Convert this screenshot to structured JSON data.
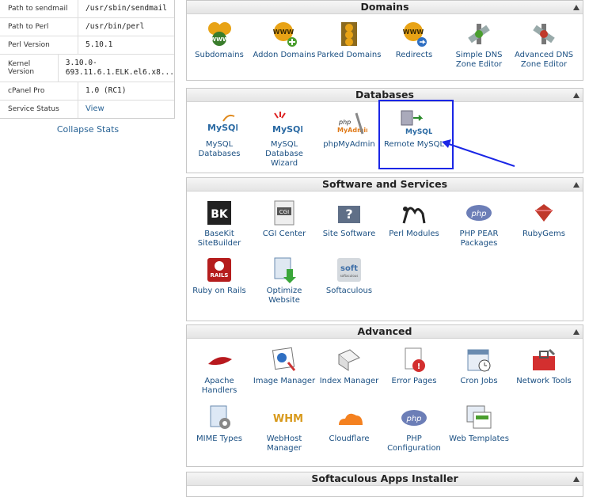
{
  "stats": {
    "rows": [
      {
        "label": "Path to sendmail",
        "value": "/usr/sbin/sendmail"
      },
      {
        "label": "Path to Perl",
        "value": "/usr/bin/perl"
      },
      {
        "label": "Perl Version",
        "value": "5.10.1"
      },
      {
        "label": "Kernel Version",
        "value": "3.10.0-\n693.11.6.1.ELK.el6.x8..."
      },
      {
        "label": "cPanel Pro",
        "value": "1.0 (RC1)"
      },
      {
        "label": "Service Status",
        "value": "View"
      }
    ],
    "collapse_label": "Collapse Stats"
  },
  "domains": {
    "title": "Domains",
    "items": [
      {
        "label": "Subdomains",
        "icon": "www-globes-icon"
      },
      {
        "label": "Addon Domains",
        "icon": "www-addon-icon"
      },
      {
        "label": "Parked Domains",
        "icon": "www-parked-icon"
      },
      {
        "label": "Redirects",
        "icon": "www-redirect-icon"
      },
      {
        "label": "Simple DNS Zone Editor",
        "icon": "dns-satellite-icon"
      },
      {
        "label": "Advanced DNS Zone Editor",
        "icon": "dns-advanced-icon"
      }
    ]
  },
  "databases": {
    "title": "Databases",
    "items": [
      {
        "label": "MySQL Databases",
        "icon": "mysql-dolphin-icon"
      },
      {
        "label": "MySQL Database Wizard",
        "icon": "mysql-wizard-icon"
      },
      {
        "label": "phpMyAdmin",
        "icon": "phpmyadmin-icon"
      },
      {
        "label": "Remote MySQL",
        "icon": "remote-mysql-icon"
      }
    ]
  },
  "software": {
    "title": "Software and Services",
    "items": [
      {
        "label": "BaseKit SiteBuilder",
        "icon": "basekit-icon"
      },
      {
        "label": "CGI Center",
        "icon": "cgi-icon"
      },
      {
        "label": "Site Software",
        "icon": "site-software-icon"
      },
      {
        "label": "Perl Modules",
        "icon": "perl-camel-icon"
      },
      {
        "label": "PHP PEAR Packages",
        "icon": "php-pear-icon"
      },
      {
        "label": "RubyGems",
        "icon": "rubygems-icon"
      },
      {
        "label": "Ruby on Rails",
        "icon": "rails-icon"
      },
      {
        "label": "Optimize Website",
        "icon": "optimize-icon"
      },
      {
        "label": "Softaculous",
        "icon": "softaculous-icon"
      }
    ]
  },
  "advanced": {
    "title": "Advanced",
    "items": [
      {
        "label": "Apache Handlers",
        "icon": "apache-feather-icon"
      },
      {
        "label": "Image Manager",
        "icon": "image-manager-icon"
      },
      {
        "label": "Index Manager",
        "icon": "index-manager-icon"
      },
      {
        "label": "Error Pages",
        "icon": "error-pages-icon"
      },
      {
        "label": "Cron Jobs",
        "icon": "cron-calendar-icon"
      },
      {
        "label": "Network Tools",
        "icon": "network-toolbox-icon"
      },
      {
        "label": "MIME Types",
        "icon": "mime-types-icon"
      },
      {
        "label": "WebHost Manager",
        "icon": "whm-icon"
      },
      {
        "label": "Cloudflare",
        "icon": "cloudflare-icon"
      },
      {
        "label": "PHP Configuration",
        "icon": "php-config-icon"
      },
      {
        "label": "Web Templates",
        "icon": "web-templates-icon"
      }
    ]
  },
  "softaculous_installer": {
    "title": "Softaculous Apps Installer"
  },
  "icon_texts": {
    "www": "WWW",
    "mysql": "MySQL",
    "php": "php",
    "myadmin": "MyAdmin",
    "bk": "BK",
    "cgi": "CGI",
    "php_logo": "php",
    "rails": "RAILS",
    "soft": "soft",
    "softaculous_small": "softaculous",
    "whm": "WHM"
  },
  "colors": {
    "link": "#1a4f82",
    "highlight": "#1a26e6"
  }
}
